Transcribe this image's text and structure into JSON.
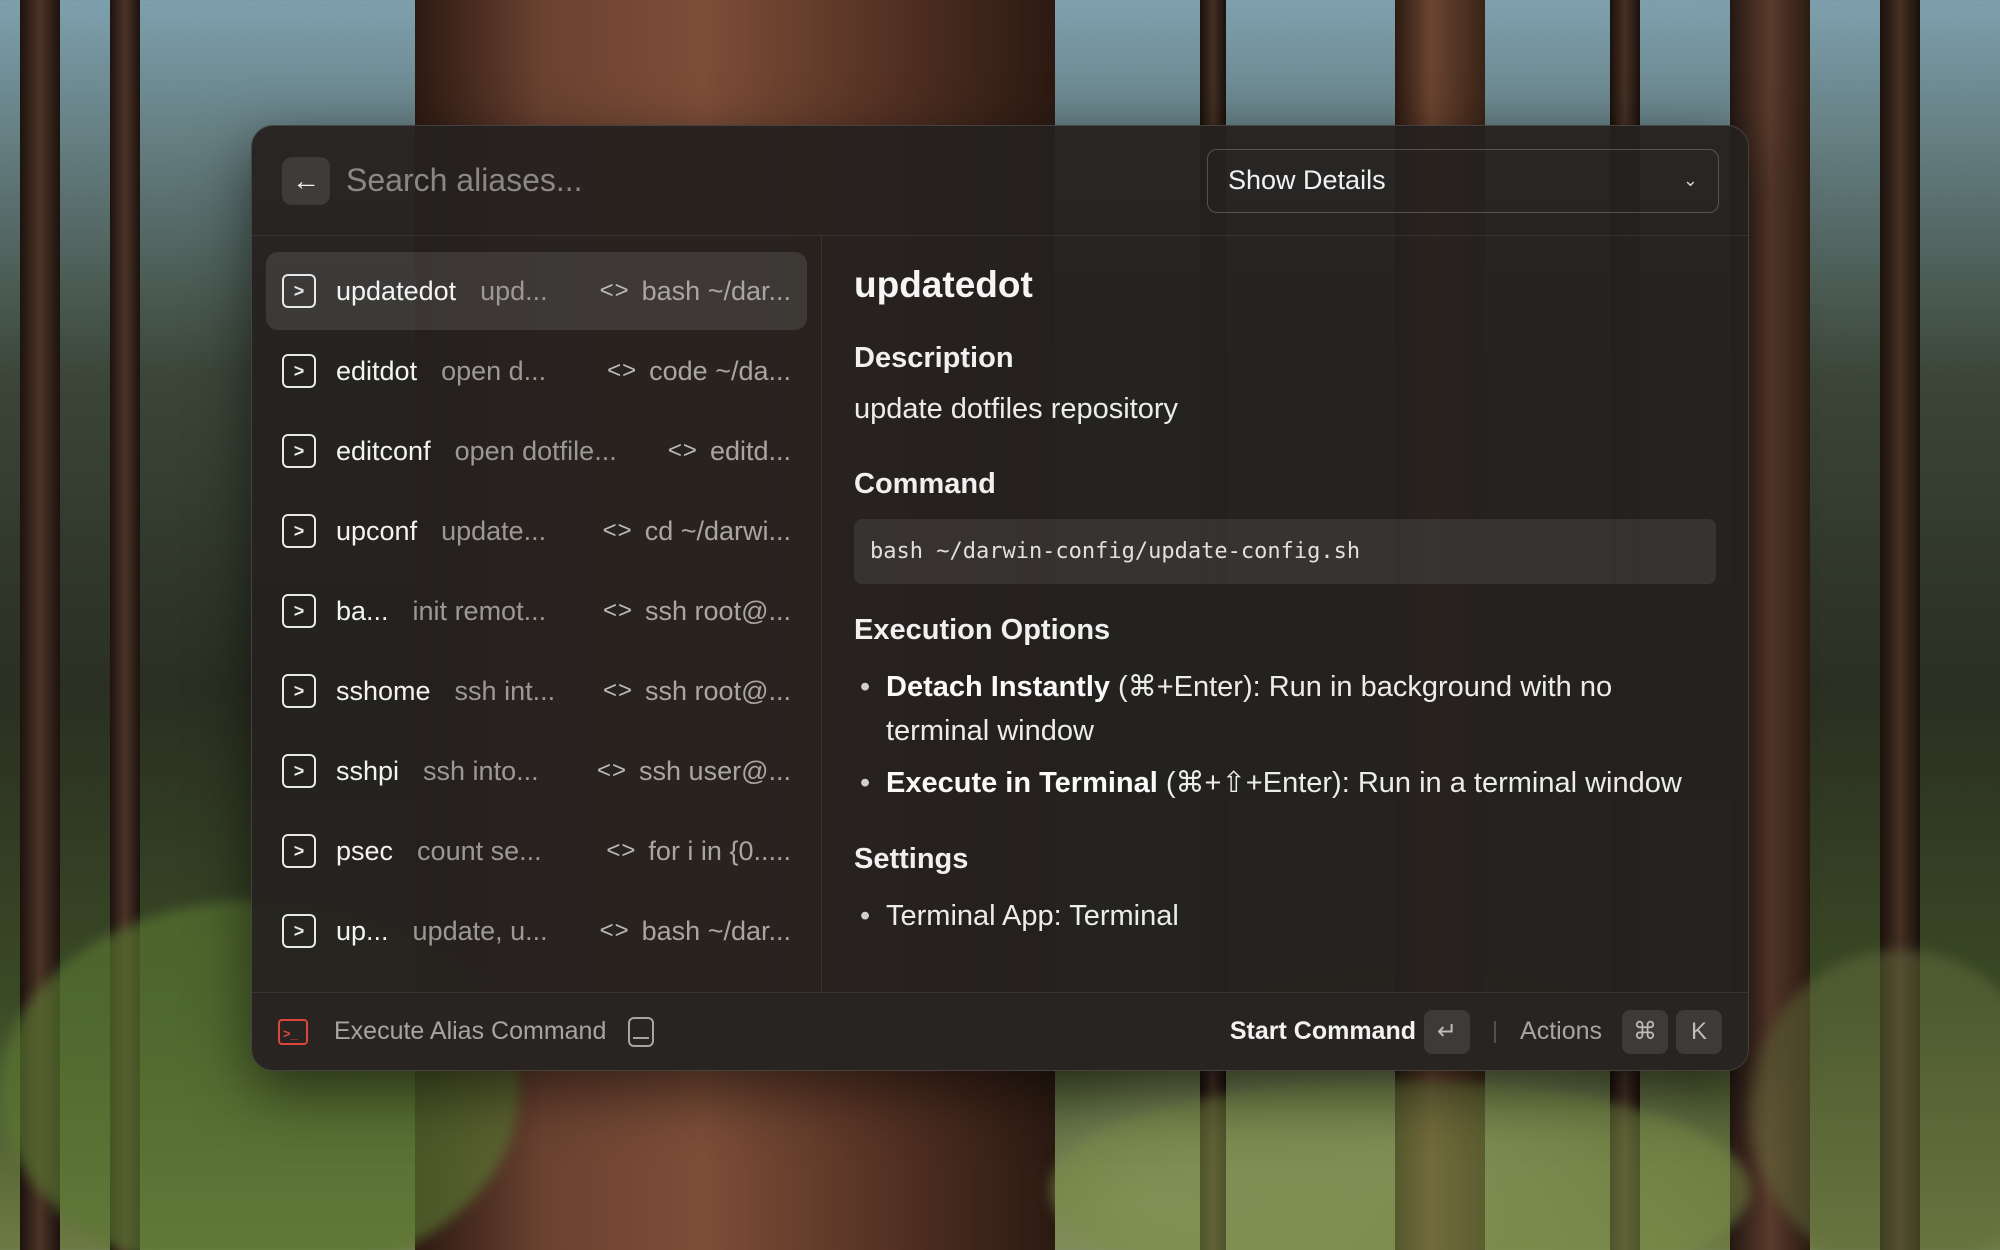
{
  "header": {
    "search_placeholder": "Search aliases...",
    "dropdown_label": "Show Details"
  },
  "aliases": [
    {
      "name": "updatedot",
      "desc": "upd...",
      "cmd": "bash ~/dar...",
      "selected": true
    },
    {
      "name": "editdot",
      "desc": "open d...",
      "cmd": "code ~/da..."
    },
    {
      "name": "editconf",
      "desc": "open dotfile...",
      "cmd": "editd..."
    },
    {
      "name": "upconf",
      "desc": "update...",
      "cmd": "cd ~/darwi..."
    },
    {
      "name": "ba...",
      "desc": "init remot...",
      "cmd": "ssh root@..."
    },
    {
      "name": "sshome",
      "desc": "ssh int...",
      "cmd": "ssh root@..."
    },
    {
      "name": "sshpi",
      "desc": "ssh into...",
      "cmd": "ssh user@..."
    },
    {
      "name": "psec",
      "desc": "count se...",
      "cmd": "for i in {0....."
    },
    {
      "name": "up...",
      "desc": "update, u...",
      "cmd": "bash ~/dar..."
    }
  ],
  "detail": {
    "title": "updatedot",
    "description_heading": "Description",
    "description": "update dotfiles repository",
    "command_heading": "Command",
    "command": "bash ~/darwin-config/update-config.sh",
    "execution_heading": "Execution Options",
    "option1_bold": "Detach Instantly",
    "option1_rest": " (⌘+Enter): Run in background with no terminal window",
    "option2_bold": "Execute in Terminal",
    "option2_rest": " (⌘+⇧+Enter): Run in a terminal window",
    "settings_heading": "Settings",
    "setting1": "Terminal App: Terminal"
  },
  "footer": {
    "command_label": "Execute Alias Command",
    "primary_action": "Start Command",
    "enter_key": "↵",
    "actions_label": "Actions",
    "cmd_key": "⌘",
    "k_key": "K"
  },
  "colors": {
    "accent_red": "#e0453d",
    "window_bg": "#24211f"
  }
}
